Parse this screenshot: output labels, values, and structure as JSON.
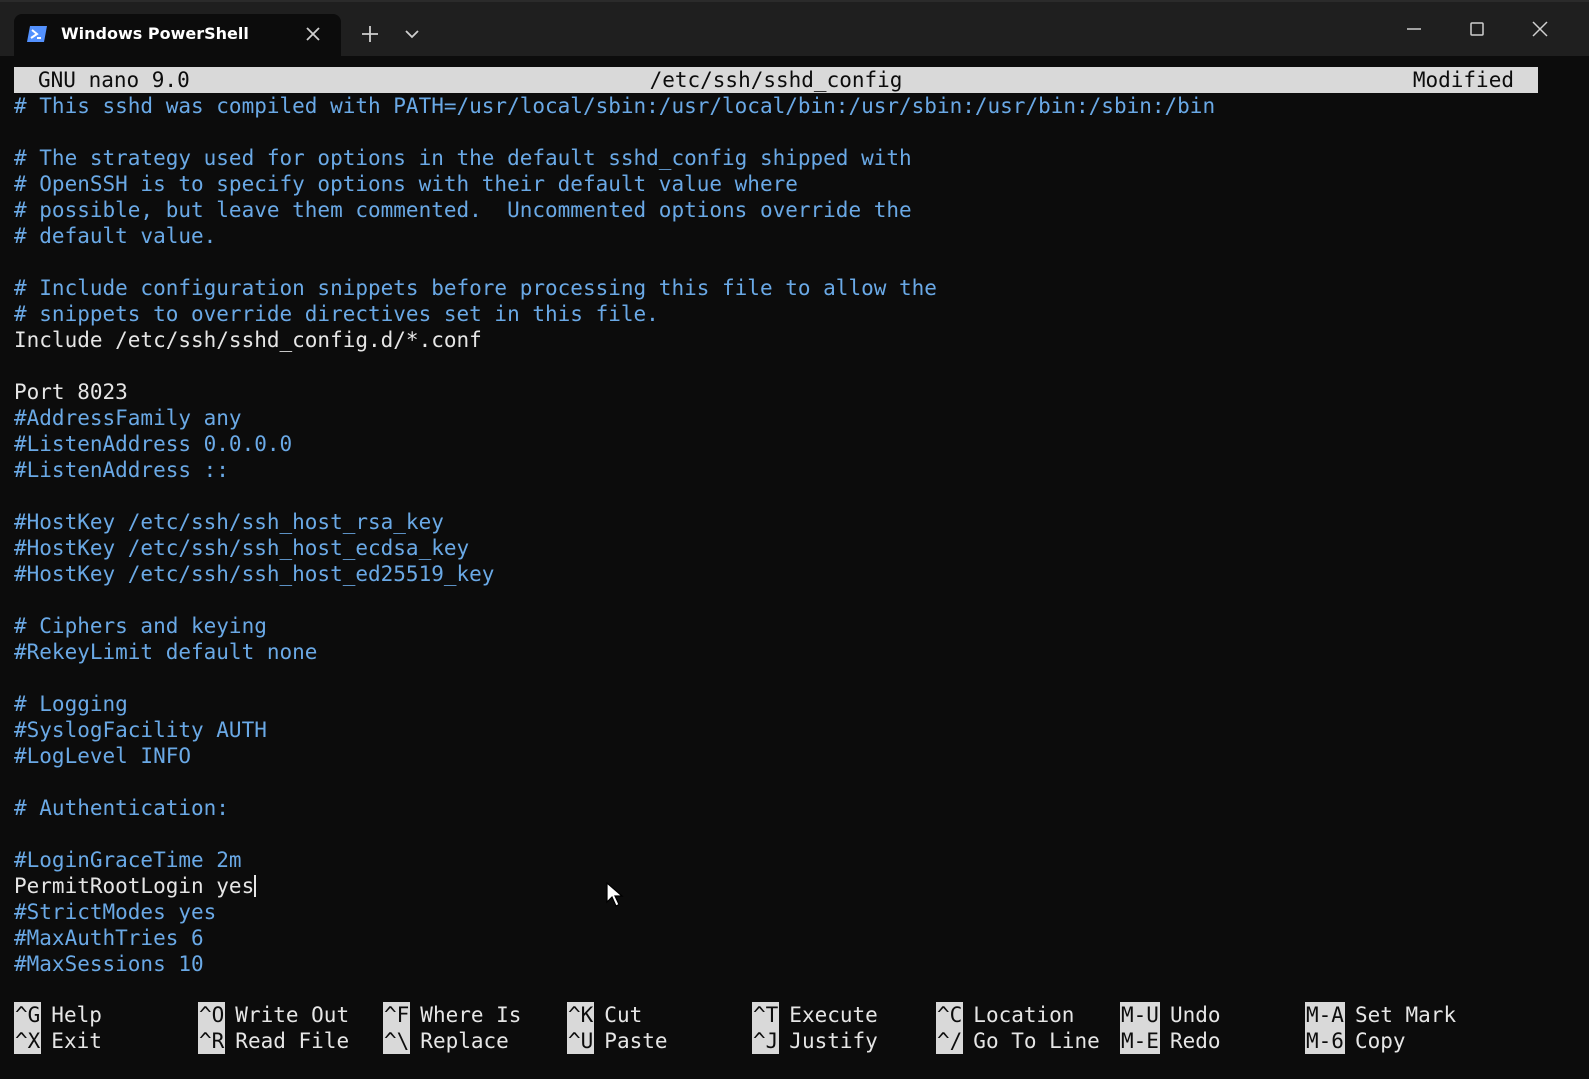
{
  "window": {
    "tab_title": "Windows PowerShell",
    "tab_icon": "powershell-icon",
    "new_tab_icon": "plus-icon",
    "dropdown_icon": "chevron-down-icon",
    "minimize_icon": "minimize-icon",
    "maximize_icon": "maximize-icon",
    "close_icon": "close-icon"
  },
  "nano": {
    "version": "GNU nano 9.0",
    "filename": "/etc/ssh/sshd_config",
    "status": "Modified"
  },
  "lines": [
    "# This sshd was compiled with PATH=/usr/local/sbin:/usr/local/bin:/usr/sbin:/usr/bin:/sbin:/bin",
    "",
    "# The strategy used for options in the default sshd_config shipped with",
    "# OpenSSH is to specify options with their default value where",
    "# possible, but leave them commented.  Uncommented options override the",
    "# default value.",
    "",
    "# Include configuration snippets before processing this file to allow the",
    "# snippets to override directives set in this file.",
    "Include /etc/ssh/sshd_config.d/*.conf",
    "",
    "Port 8023",
    "#AddressFamily any",
    "#ListenAddress 0.0.0.0",
    "#ListenAddress ::",
    "",
    "#HostKey /etc/ssh/ssh_host_rsa_key",
    "#HostKey /etc/ssh/ssh_host_ecdsa_key",
    "#HostKey /etc/ssh/ssh_host_ed25519_key",
    "",
    "# Ciphers and keying",
    "#RekeyLimit default none",
    "",
    "# Logging",
    "#SyslogFacility AUTH",
    "#LogLevel INFO",
    "",
    "# Authentication:",
    "",
    "#LoginGraceTime 2m",
    "PermitRootLogin yes",
    "#StrictModes yes",
    "#MaxAuthTries 6",
    "#MaxSessions 10"
  ],
  "shortcuts": [
    {
      "key": "^G",
      "label": "Help"
    },
    {
      "key": "^O",
      "label": "Write Out"
    },
    {
      "key": "^F",
      "label": "Where Is"
    },
    {
      "key": "^K",
      "label": "Cut"
    },
    {
      "key": "^T",
      "label": "Execute"
    },
    {
      "key": "^C",
      "label": "Location"
    },
    {
      "key": "M-U",
      "label": "Undo"
    },
    {
      "key": "M-A",
      "label": "Set Mark"
    },
    {
      "key": "^X",
      "label": "Exit"
    },
    {
      "key": "^R",
      "label": "Read File"
    },
    {
      "key": "^\\",
      "label": "Replace"
    },
    {
      "key": "^U",
      "label": "Paste"
    },
    {
      "key": "^J",
      "label": "Justify"
    },
    {
      "key": "^/",
      "label": "Go To Line"
    },
    {
      "key": "M-E",
      "label": "Redo"
    },
    {
      "key": "M-6",
      "label": "Copy"
    }
  ],
  "colors": {
    "background": "#0c0c0c",
    "titlebar": "#1f1f1f",
    "comment": "#6aa9e6",
    "text": "#e6e6e6",
    "header_bg": "#d9d9d9"
  }
}
